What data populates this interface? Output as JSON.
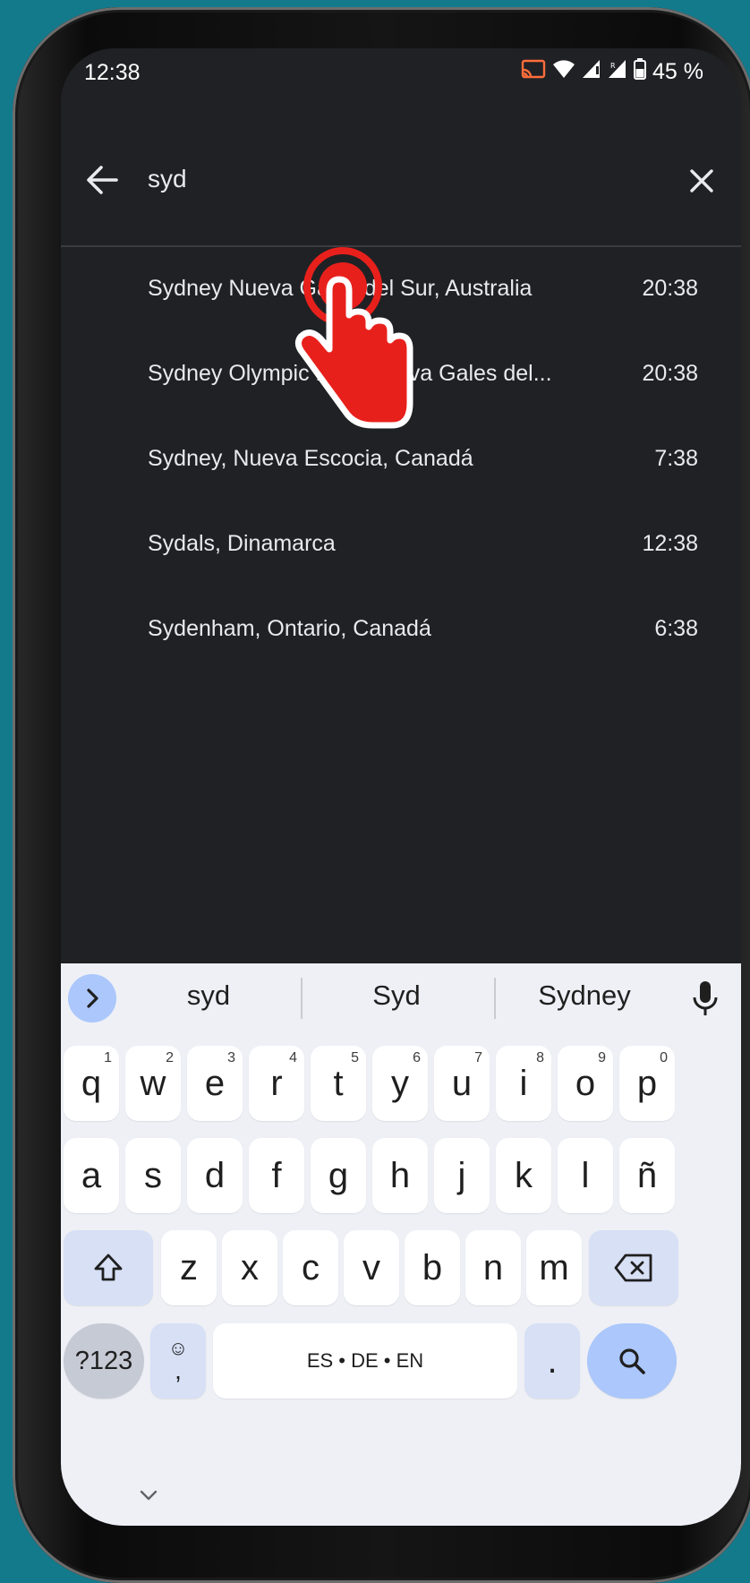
{
  "status_bar": {
    "time": "12:38",
    "battery_percent": "45 %"
  },
  "search": {
    "query": "syd"
  },
  "results": [
    {
      "name": "Sydney Nueva Gales del Sur, Australia",
      "time": "20:38"
    },
    {
      "name": "Sydney Olympic Park Nueva Gales del...",
      "time": "20:38"
    },
    {
      "name": "Sydney, Nueva Escocia, Canadá",
      "time": "7:38"
    },
    {
      "name": "Sydals, Dinamarca",
      "time": "12:38"
    },
    {
      "name": "Sydenham, Ontario, Canadá",
      "time": "6:38"
    }
  ],
  "keyboard": {
    "suggestions": [
      "syd",
      "Syd",
      "Sydney"
    ],
    "row1": [
      {
        "k": "q",
        "h": "1"
      },
      {
        "k": "w",
        "h": "2"
      },
      {
        "k": "e",
        "h": "3"
      },
      {
        "k": "r",
        "h": "4"
      },
      {
        "k": "t",
        "h": "5"
      },
      {
        "k": "y",
        "h": "6"
      },
      {
        "k": "u",
        "h": "7"
      },
      {
        "k": "i",
        "h": "8"
      },
      {
        "k": "o",
        "h": "9"
      },
      {
        "k": "p",
        "h": "0"
      }
    ],
    "row2": [
      "a",
      "s",
      "d",
      "f",
      "g",
      "h",
      "j",
      "k",
      "l",
      "ñ"
    ],
    "row3": [
      "z",
      "x",
      "c",
      "v",
      "b",
      "n",
      "m"
    ],
    "symbols_label": "?123",
    "comma_label": ",",
    "space_label": "ES • DE • EN",
    "period_label": "."
  },
  "colors": {
    "background": "#137a8c",
    "screen": "#202124",
    "keyboard": "#eef0f6",
    "accent": "#abc7fb",
    "tap_indicator": "#e8201c"
  }
}
